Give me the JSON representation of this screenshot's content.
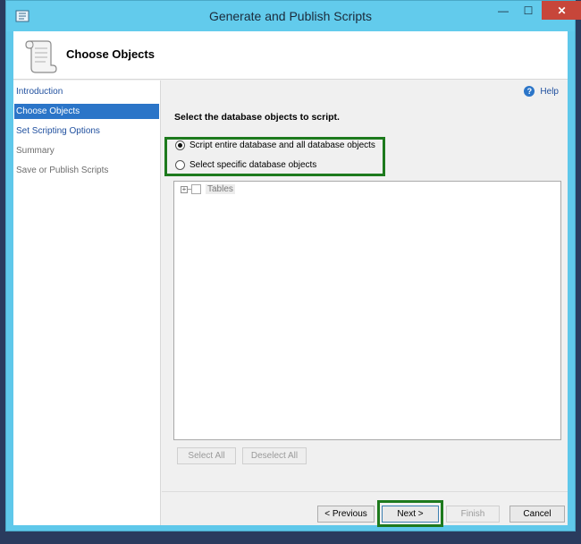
{
  "window": {
    "title": "Generate and Publish Scripts",
    "controls": {
      "minimize": "—",
      "maximize": "☐",
      "close": "✕"
    }
  },
  "header": {
    "title": "Choose Objects",
    "icon": "scroll-icon"
  },
  "nav": {
    "items": [
      {
        "label": "Introduction",
        "state": "link"
      },
      {
        "label": "Choose Objects",
        "state": "selected"
      },
      {
        "label": "Set Scripting Options",
        "state": "link"
      },
      {
        "label": "Summary",
        "state": "disabled"
      },
      {
        "label": "Save or Publish Scripts",
        "state": "disabled"
      }
    ]
  },
  "main": {
    "help_label": "Help",
    "instruction": "Select the database objects to script.",
    "radios": [
      {
        "label": "Script entire database and all database objects",
        "checked": true
      },
      {
        "label": "Select specific database objects",
        "checked": false
      }
    ],
    "tree": {
      "expander": "+",
      "items": [
        {
          "label": "Tables"
        }
      ]
    },
    "select_all": "Select All",
    "deselect_all": "Deselect All"
  },
  "footer": {
    "previous": "< Previous",
    "next": "Next >",
    "finish": "Finish",
    "cancel": "Cancel"
  },
  "colors": {
    "titlebar": "#62cbec",
    "highlight_frame": "#1d7a1d",
    "nav_selected": "#2b75c8",
    "close_button": "#c7463a"
  }
}
